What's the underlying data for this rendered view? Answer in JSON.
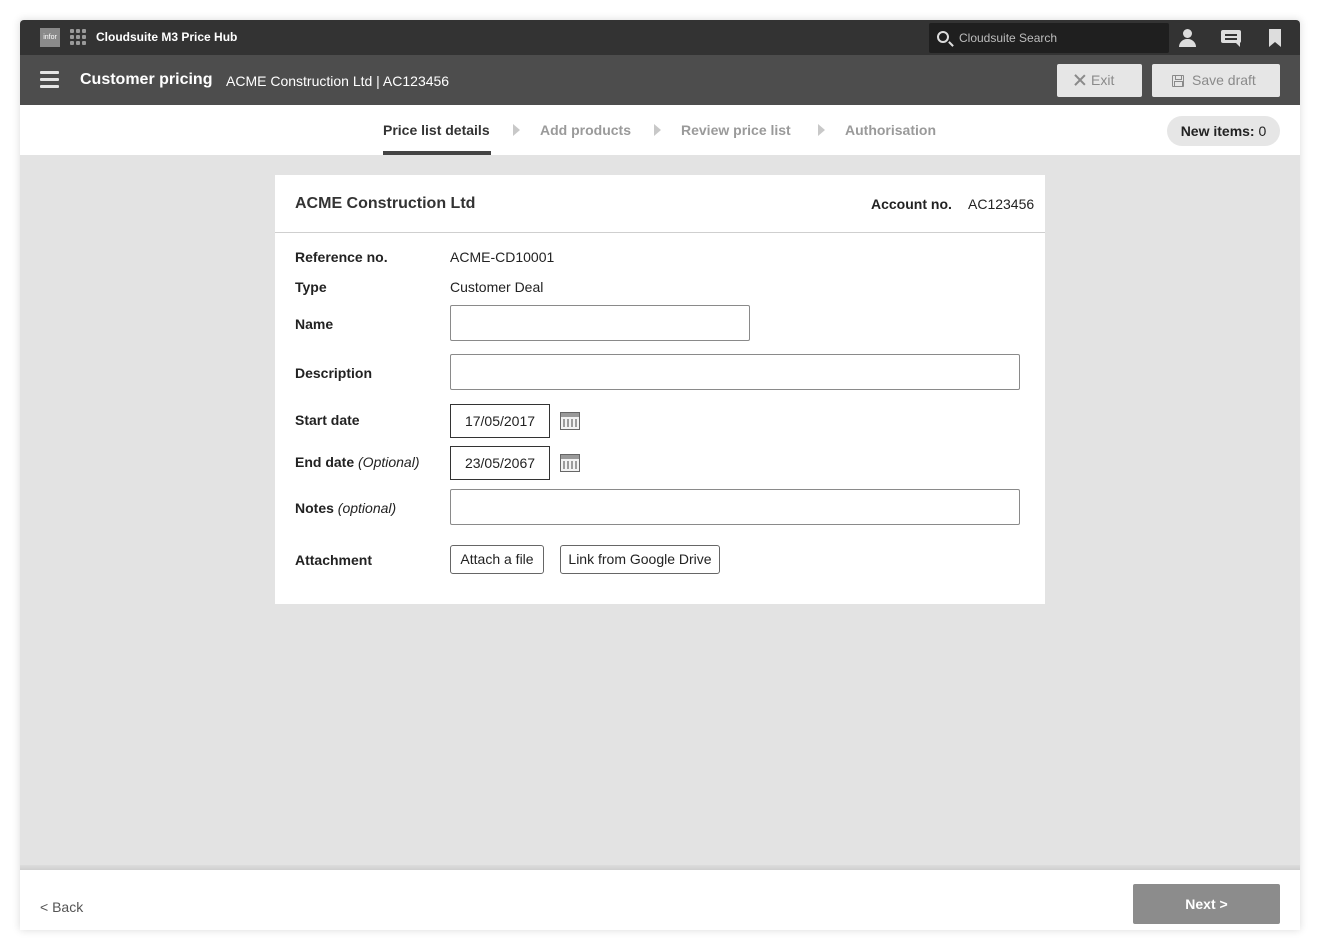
{
  "topbar": {
    "logo_text": "infor",
    "app_title": "Cloudsuite M3 Price Hub",
    "search_placeholder": "Cloudsuite Search"
  },
  "header": {
    "title": "Customer pricing",
    "subtitle": "ACME Construction Ltd | AC123456",
    "exit_label": "Exit",
    "save_label": "Save draft"
  },
  "steps": {
    "items": [
      "Price list details",
      "Add products",
      "Review price list",
      "Authorisation"
    ],
    "active_index": 0,
    "new_items_label": "New items:",
    "new_items_count": "0"
  },
  "card": {
    "company": "ACME Construction Ltd",
    "account_label": "Account no.",
    "account_value": "AC123456",
    "reference_label": "Reference no.",
    "reference_value": "ACME-CD10001",
    "type_label": "Type",
    "type_value": "Customer Deal",
    "name_label": "Name",
    "name_value": "",
    "description_label": "Description",
    "description_value": "",
    "start_label": "Start date",
    "start_value": "17/05/2017",
    "end_label": "End date",
    "end_optional": "(Optional)",
    "end_value": "23/05/2067",
    "notes_label": "Notes",
    "notes_optional": "(optional)",
    "notes_value": "",
    "attachment_label": "Attachment",
    "attach_file_label": "Attach a file",
    "google_drive_label": "Link from Google Drive"
  },
  "footer": {
    "back_label": "< Back",
    "next_label": "Next >"
  },
  "colors": {
    "topbar": "#333333",
    "header": "#4d4d4d",
    "content_bg": "#e3e3e3",
    "next_button": "#8c8c8c"
  }
}
